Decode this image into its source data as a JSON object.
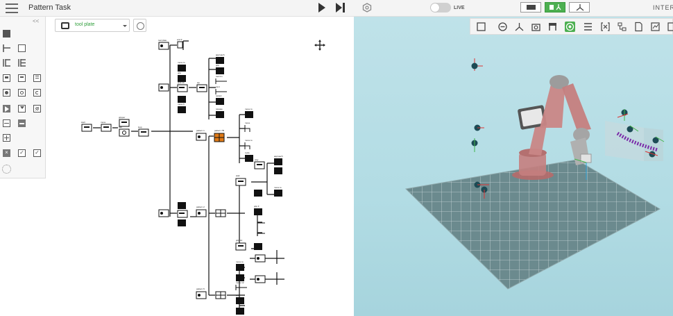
{
  "header": {
    "menu_icon": "hamburger-menu-icon",
    "title": "Pattern Task",
    "play_icon": "play-icon",
    "step_icon": "step-forward-icon",
    "settings_icon": "hexagon-settings-icon",
    "live_label": "LIVE",
    "right_label": "INTER"
  },
  "palette": {
    "collapse_label": "<<"
  },
  "tree_toolbar": {
    "selector_value": "tool plate"
  },
  "tree_nodes": {
    "n_main": "start",
    "n_move": "move",
    "n_grip": "gripper",
    "n_tool": "tool",
    "n_loop": "loop",
    "n_a1": "tool plate",
    "n_a2": "end fr",
    "n_b1": "move to",
    "n_b2": "grip",
    "n_b3": "pick 14",
    "n_b4": "wp",
    "n_b5": "move fr",
    "n_c1": "approach",
    "n_c2": "grip",
    "n_c3": "next",
    "n_c4": "tool lim",
    "n_c5": "retract",
    "n_c6": "release",
    "n_d1": "pattern 1",
    "n_d2": "pattern 7B",
    "n_e1": "move to",
    "n_e2": "move",
    "n_e3": "move to",
    "n_e4": "cycle",
    "n_f1": "approach",
    "n_f2": "move to",
    "n_f3": "way",
    "n_g1": "pattern 2",
    "n_g2": "wait",
    "n_g3": "grip fr",
    "n_g4": "grip 14",
    "n_h1": "move to",
    "n_h2": "move 5",
    "n_h3": "approach",
    "n_i1": "pattern 5",
    "n_i2": "move to",
    "n_i3": "move 12",
    "n_i4": "grip"
  },
  "viewport": {
    "label": "3D robot viewport"
  }
}
